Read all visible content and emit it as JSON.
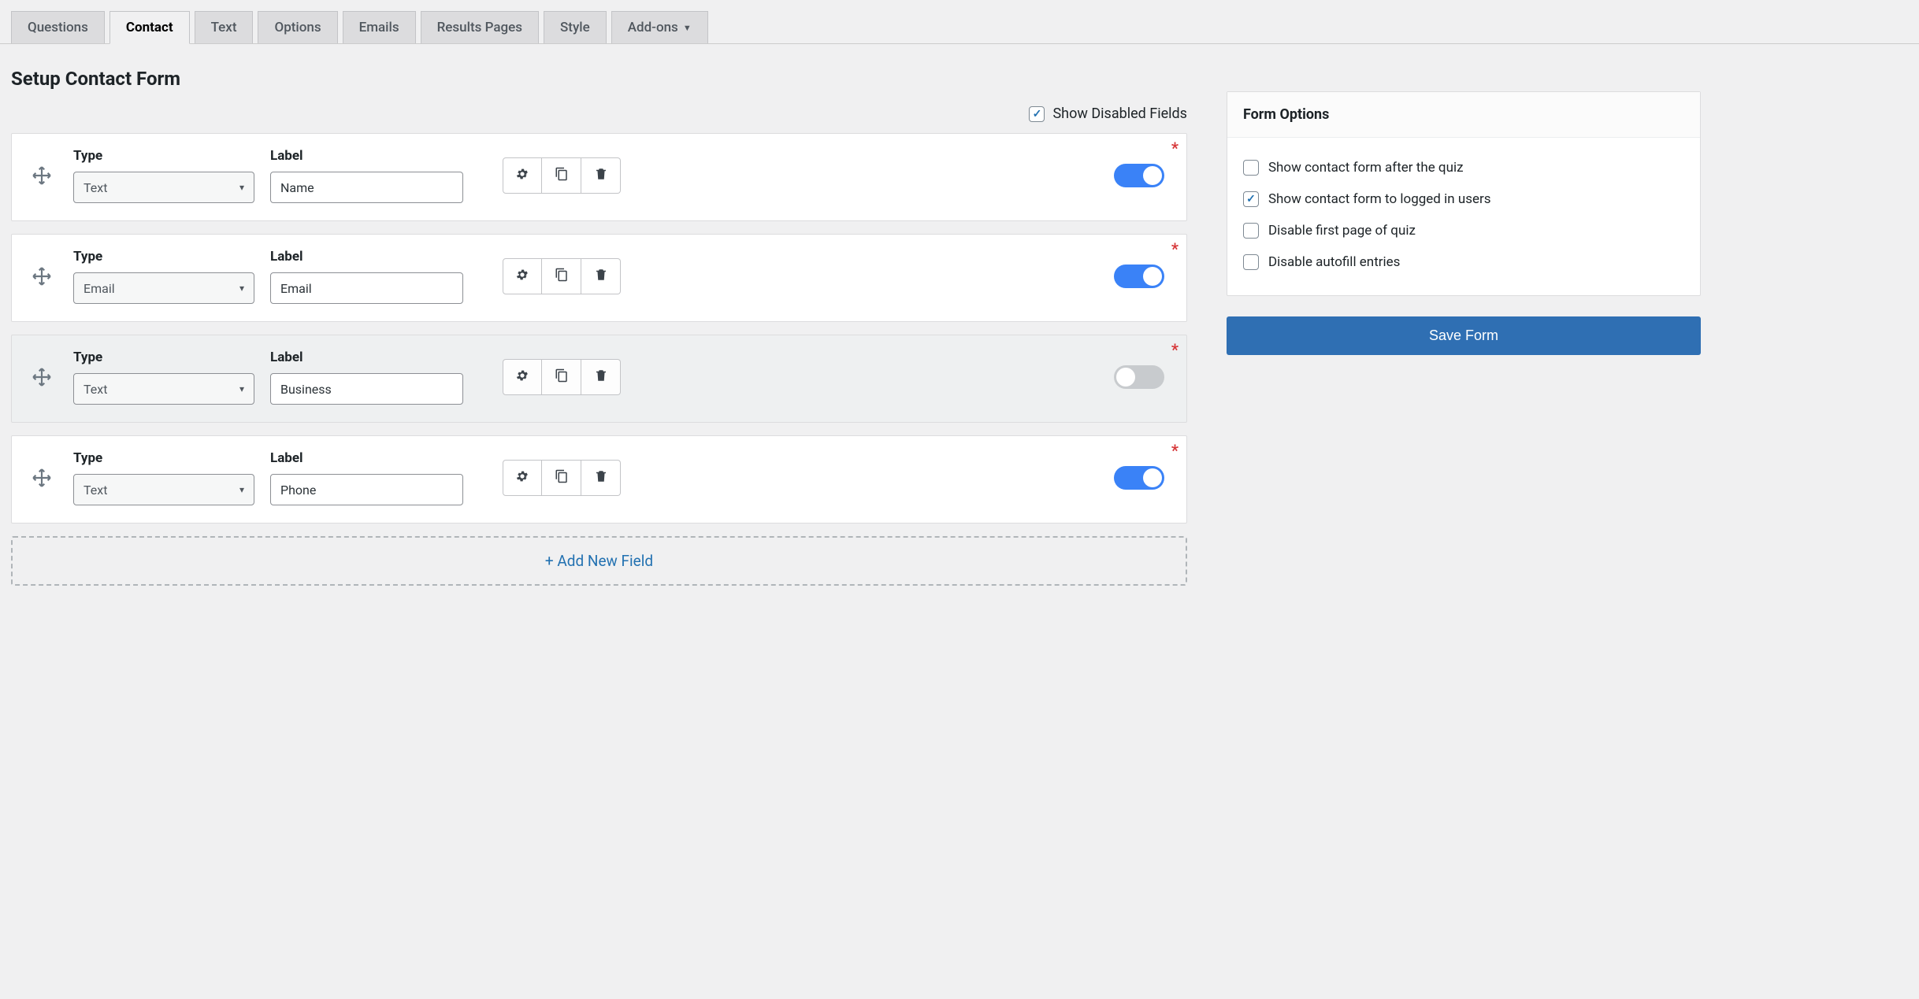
{
  "tabs": [
    {
      "label": "Questions",
      "active": false
    },
    {
      "label": "Contact",
      "active": true
    },
    {
      "label": "Text",
      "active": false
    },
    {
      "label": "Options",
      "active": false
    },
    {
      "label": "Emails",
      "active": false
    },
    {
      "label": "Results Pages",
      "active": false
    },
    {
      "label": "Style",
      "active": false
    },
    {
      "label": "Add-ons",
      "active": false,
      "dropdown": true
    }
  ],
  "page_title": "Setup Contact Form",
  "show_disabled": {
    "label": "Show Disabled Fields",
    "checked": true
  },
  "headers": {
    "type": "Type",
    "label": "Label"
  },
  "fields": [
    {
      "type": "Text",
      "label": "Name",
      "enabled": true,
      "required": true
    },
    {
      "type": "Email",
      "label": "Email",
      "enabled": true,
      "required": true
    },
    {
      "type": "Text",
      "label": "Business",
      "enabled": false,
      "required": true
    },
    {
      "type": "Text",
      "label": "Phone",
      "enabled": true,
      "required": true
    }
  ],
  "add_new_label": "+ Add New Field",
  "form_options": {
    "title": "Form Options",
    "items": [
      {
        "label": "Show contact form after the quiz",
        "checked": false
      },
      {
        "label": "Show contact form to logged in users",
        "checked": true
      },
      {
        "label": "Disable first page of quiz",
        "checked": false
      },
      {
        "label": "Disable autofill entries",
        "checked": false
      }
    ]
  },
  "save_label": "Save Form"
}
